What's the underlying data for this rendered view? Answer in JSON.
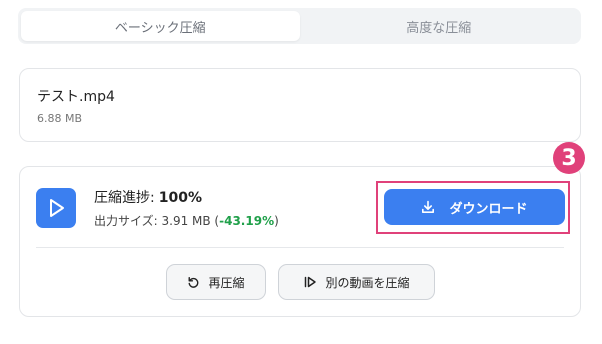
{
  "tabs": [
    {
      "label": "ベーシック圧縮",
      "active": true
    },
    {
      "label": "高度な圧縮",
      "active": false
    }
  ],
  "file": {
    "name": "テスト.mp4",
    "size": "6.88 MB"
  },
  "result": {
    "progress_label": "圧縮進捗:",
    "progress_value": "100%",
    "output_label": "出力サイズ: 3.91 MB (",
    "output_pct": "-43.19%",
    "output_close": ")",
    "download_label": "ダウンロード",
    "recompress_label": "再圧縮",
    "compress_other_label": "別の動画を圧縮"
  },
  "annotation": {
    "step_number": "3"
  },
  "colors": {
    "accent": "#3b7ff0",
    "highlight": "#e0417a",
    "saving": "#20a04a"
  }
}
